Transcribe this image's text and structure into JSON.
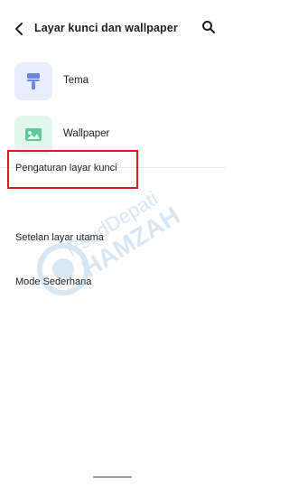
{
  "header": {
    "back_icon": "chevron-left-icon",
    "title": "Layar kunci dan wallpaper",
    "search_icon": "search-icon"
  },
  "items": [
    {
      "label": "Tema",
      "icon": "paint-roller-icon",
      "icon_bg": "#e8edfb",
      "icon_color": "#6f86e6"
    },
    {
      "label": "Wallpaper",
      "icon": "image-icon",
      "icon_bg": "#e3f6ec",
      "icon_color": "#5cc999"
    }
  ],
  "settings": [
    {
      "label": "Pengaturan layar kunci"
    },
    {
      "label": "Setelan layar utama"
    },
    {
      "label": "Mode Sederhana"
    }
  ],
  "watermark": {
    "line1": "RsudDepati",
    "line2": "HAMZAH",
    "color": "#2f7fc4"
  },
  "colors": {
    "highlight": "#e3161b"
  }
}
